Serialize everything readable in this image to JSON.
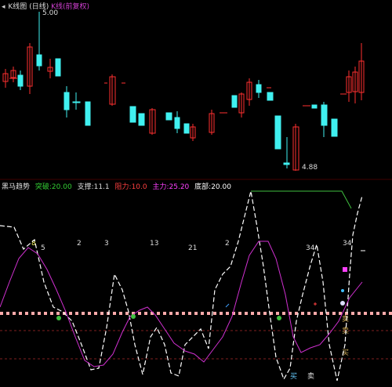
{
  "header": {
    "arrow": "◂",
    "title": "K线图",
    "period": "(日线)",
    "indicator": "K线(前复权)"
  },
  "price_labels": {
    "high": "5.00",
    "low": "4.88"
  },
  "indicator_legend": {
    "name": "黑马趋势",
    "items": [
      {
        "text": "突破:20.00",
        "color": "#33cc33"
      },
      {
        "text": "支撑:11.1",
        "color": "#dddddd"
      },
      {
        "text": "阻力:10.0",
        "color": "#ff4040"
      },
      {
        "text": "主力:25.20",
        "color": "#ff40ff"
      },
      {
        "text": "底部:20.00",
        "color": "#ffffff"
      }
    ]
  },
  "day_counts": [
    "8",
    "5",
    "2",
    "3",
    "13",
    "21",
    "2",
    "34",
    "34"
  ],
  "bottom_marks": [
    "买",
    "卖",
    "买",
    "卖",
    "卖"
  ],
  "colors": {
    "up": "#ff3030",
    "down": "#40f0f0",
    "white": "#ffffff",
    "magenta": "#d030d0",
    "green": "#40c040",
    "salmon": "#ffaaaa",
    "darkred": "#802020"
  }
}
